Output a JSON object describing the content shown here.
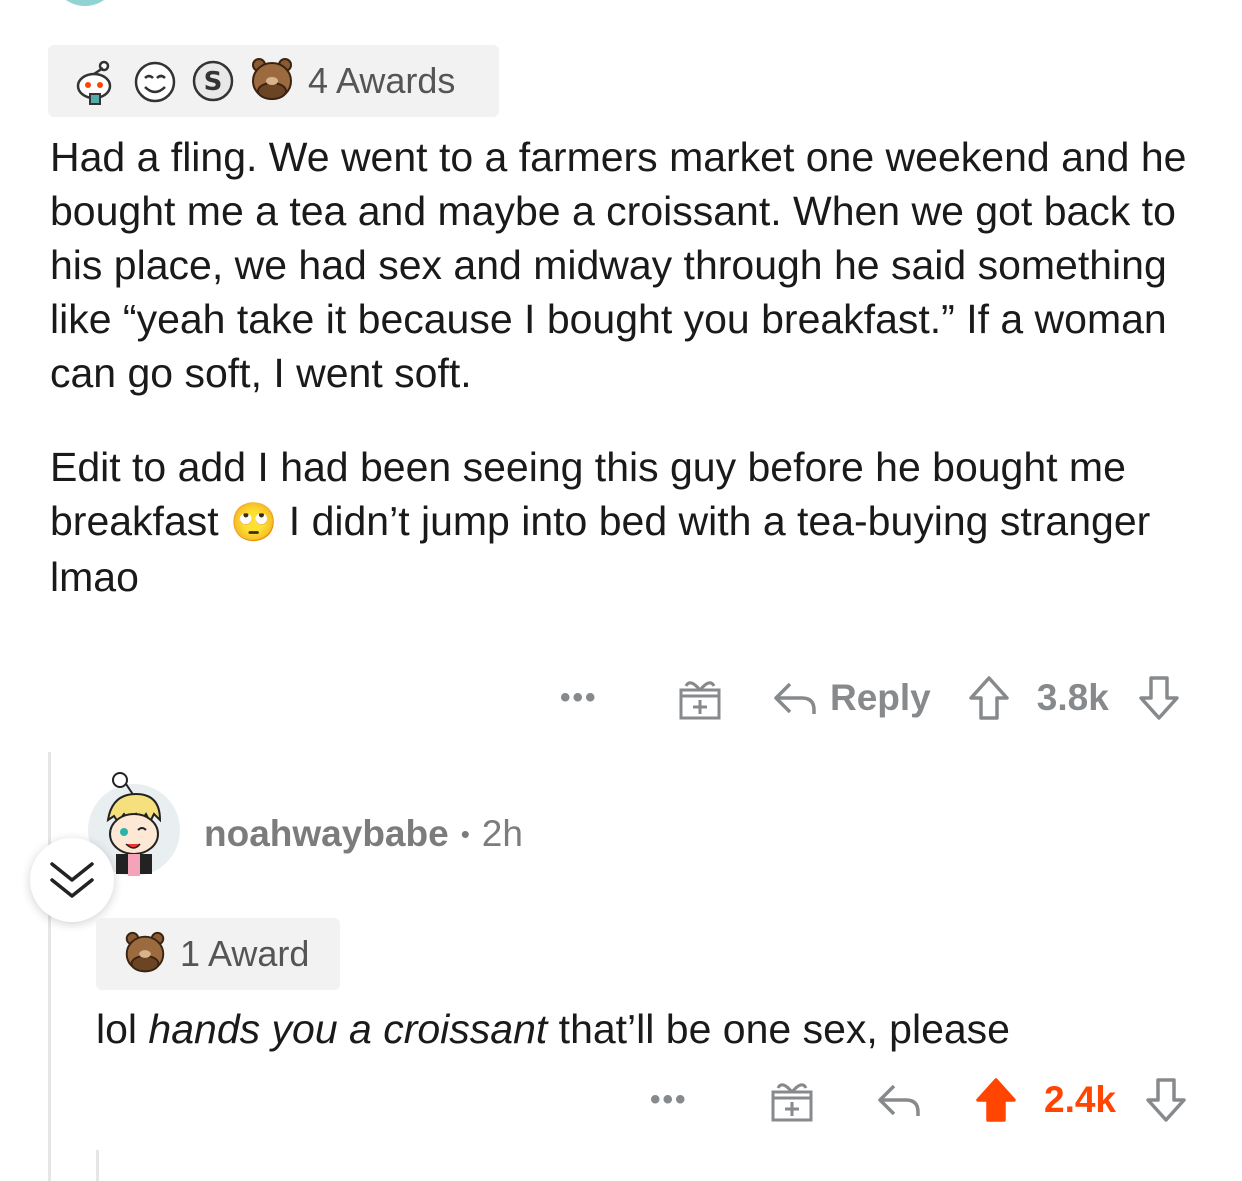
{
  "parent_comment": {
    "awards_label": "4 Awards",
    "award_icons": [
      "snoo-wholesome-award-icon",
      "laughing-face-award-icon",
      "silver-coin-award-icon",
      "facepalm-bear-award-icon"
    ],
    "paragraph_1": "Had a fling. We went to a farmers market one weekend and he bought me a tea and maybe a croissant. When we got back to his place, we had sex and midway through he said something like “yeah take it because I bought you breakfast.” If a woman can go soft, I went soft.",
    "paragraph_2_before_emoji": "Edit to add I had been seeing this guy before he bought me breakfast",
    "paragraph_2_emoji": "🙄",
    "paragraph_2_after_emoji": " I didn’t jump into bed with a tea-buying stranger lmao",
    "actions": {
      "more": "•••",
      "reply_label": "Reply",
      "score": "3.8k"
    }
  },
  "child_comment": {
    "username": "noahwaybabe",
    "separator": "•",
    "age": "2h",
    "awards_label": "1 Award",
    "award_icons": [
      "facepalm-bear-award-icon"
    ],
    "text_prefix": "lol ",
    "text_italic": "hands you a croissant",
    "text_suffix": " that’ll be one sex, please",
    "actions": {
      "more": "•••",
      "score": "2.4k"
    }
  },
  "colors": {
    "upvoted": "#ff4500",
    "action_gray": "#878a8c",
    "text": "#1a1a1b",
    "award_bg": "#f2f2f2"
  }
}
